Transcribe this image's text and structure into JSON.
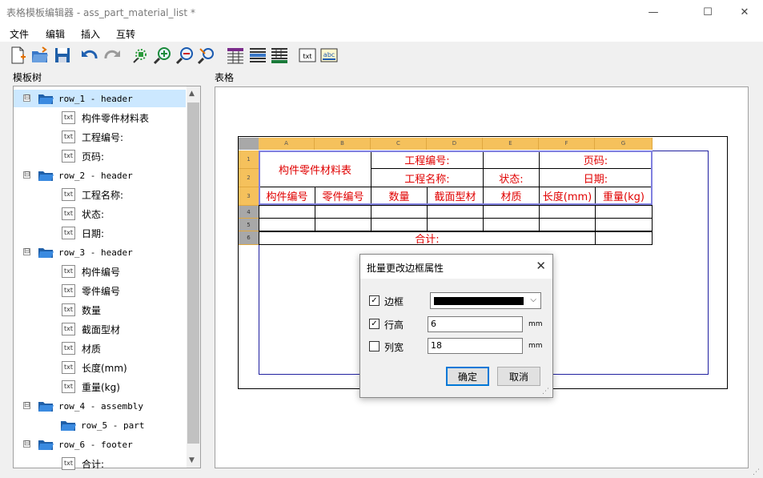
{
  "window": {
    "title": "表格模板编辑器 - ass_part_material_list *",
    "minimize": "—",
    "maximize": "☐",
    "close": "✕"
  },
  "menu": [
    "文件",
    "编辑",
    "插入",
    "互转"
  ],
  "toolbar_icons": [
    "new-file-icon",
    "open-folder-icon",
    "save-icon",
    "undo-icon",
    "redo-icon",
    "zoom-fit-icon",
    "zoom-in-icon",
    "zoom-out-icon",
    "zoom-reset-icon",
    "insert-table-icon",
    "insert-rows-icon",
    "insert-columns-icon",
    "text-box-icon",
    "label-icon"
  ],
  "toolbar_text": {
    "txt": "txt",
    "abc": "abc"
  },
  "panels": {
    "tree_title": "模板树",
    "grid_title": "表格"
  },
  "tree": [
    {
      "type": "group",
      "label": "row_1 - header",
      "toggle": "⊟"
    },
    {
      "type": "txt",
      "label": "构件零件材料表"
    },
    {
      "type": "txt",
      "label": "工程编号:"
    },
    {
      "type": "txt",
      "label": "页码:"
    },
    {
      "type": "group",
      "label": "row_2 - header",
      "toggle": "⊟"
    },
    {
      "type": "txt",
      "label": "工程名称:"
    },
    {
      "type": "txt",
      "label": "状态:"
    },
    {
      "type": "txt",
      "label": "日期:"
    },
    {
      "type": "group",
      "label": "row_3 - header",
      "toggle": "⊟"
    },
    {
      "type": "txt",
      "label": "构件编号"
    },
    {
      "type": "txt",
      "label": "零件编号"
    },
    {
      "type": "txt",
      "label": "数量"
    },
    {
      "type": "txt",
      "label": "截面型材"
    },
    {
      "type": "txt",
      "label": "材质"
    },
    {
      "type": "txt",
      "label": "长度(mm)"
    },
    {
      "type": "txt",
      "label": "重量(kg)"
    },
    {
      "type": "group",
      "label": "row_4 - assembly",
      "toggle": "⊟"
    },
    {
      "type": "sub",
      "label": "row_5 - part"
    },
    {
      "type": "group",
      "label": "row_6 - footer",
      "toggle": "⊟"
    },
    {
      "type": "txt",
      "label": "合计:"
    }
  ],
  "txt_icon_label": "txt",
  "sheet": {
    "columns": [
      "A",
      "B",
      "C",
      "D",
      "E",
      "F",
      "G"
    ],
    "rows": [
      "1",
      "2",
      "3",
      "4",
      "5",
      "6"
    ],
    "title": "构件零件材料表",
    "project_no": "工程编号:",
    "page": "页码:",
    "project_name": "工程名称:",
    "status": "状态:",
    "date": "日期:",
    "headers": [
      "构件编号",
      "零件编号",
      "数量",
      "截面型材",
      "材质",
      "长度(mm)",
      "重量(kg)"
    ],
    "total": "合计:"
  },
  "dialog": {
    "title": "批量更改边框属性",
    "close": "✕",
    "border_label": "边框",
    "border_checked": "✓",
    "row_height_label": "行高",
    "row_height_checked": "✓",
    "row_height_value": "6",
    "col_width_label": "列宽",
    "col_width_value": "18",
    "unit": "mm",
    "ok": "确定",
    "cancel": "取消",
    "border_color": "#000000"
  },
  "colors": {
    "accent_header": "#f5c15c",
    "cell_text": "#e00000",
    "selection": "#8080e0"
  }
}
